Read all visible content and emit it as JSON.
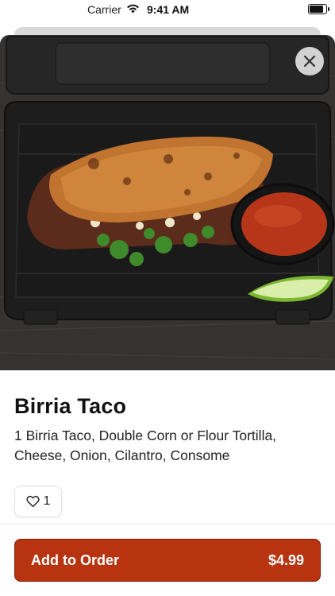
{
  "status_bar": {
    "carrier": "Carrier",
    "time": "9:41 AM",
    "icons": [
      "wifi-icon",
      "battery-icon"
    ]
  },
  "hero": {
    "image_alt": "",
    "close_icon": "close-icon"
  },
  "item": {
    "title": "Birria Taco",
    "description": "1 Birria Taco, Double Corn or Flour Tortilla, Cheese, Onion, Cilantro, Consome",
    "like_icon": "heart-outline-icon",
    "like_count": "1"
  },
  "order_button": {
    "label": "Add to Order",
    "price": "$4.99"
  },
  "colors": {
    "accent": "#b83410",
    "accent_border": "#7e2208",
    "text": "#111111"
  }
}
